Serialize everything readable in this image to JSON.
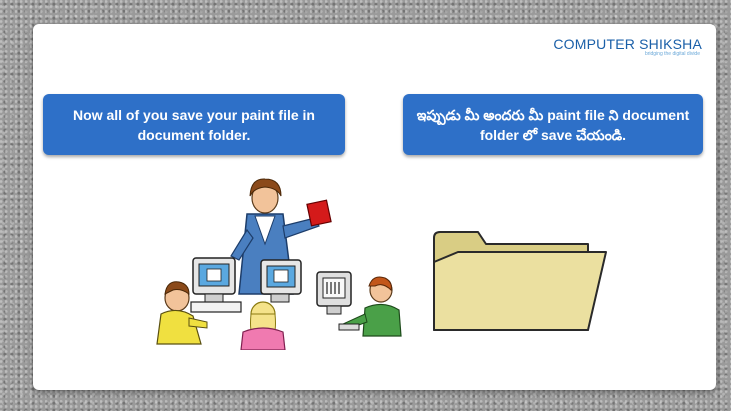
{
  "logo": {
    "brand": "COMPUTER SHIKSHA",
    "tagline": "bridging the digital divide"
  },
  "left_bubble": {
    "text": "Now all of you save your paint file in document folder."
  },
  "right_bubble": {
    "text": "ఇప్పుడు మీ అందరు మీ paint file ని document folder లో save చేయండి."
  },
  "illustration": {
    "icon": "teacher-with-students-at-computers"
  },
  "folder": {
    "icon": "folder-icon"
  },
  "colors": {
    "bubble": "#2e70c8",
    "brand": "#1a5fa8",
    "folder": "#e8dc9a"
  }
}
